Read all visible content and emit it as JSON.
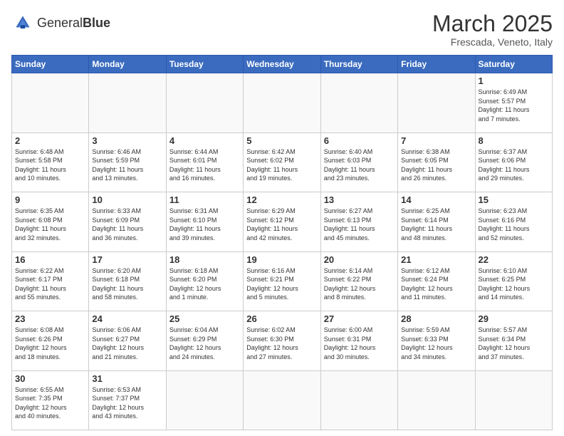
{
  "logo": {
    "text_normal": "General",
    "text_bold": "Blue"
  },
  "header": {
    "month": "March 2025",
    "location": "Frescada, Veneto, Italy"
  },
  "days_of_week": [
    "Sunday",
    "Monday",
    "Tuesday",
    "Wednesday",
    "Thursday",
    "Friday",
    "Saturday"
  ],
  "weeks": [
    [
      {
        "day": "",
        "info": ""
      },
      {
        "day": "",
        "info": ""
      },
      {
        "day": "",
        "info": ""
      },
      {
        "day": "",
        "info": ""
      },
      {
        "day": "",
        "info": ""
      },
      {
        "day": "",
        "info": ""
      },
      {
        "day": "1",
        "info": "Sunrise: 6:49 AM\nSunset: 5:57 PM\nDaylight: 11 hours\nand 7 minutes."
      }
    ],
    [
      {
        "day": "2",
        "info": "Sunrise: 6:48 AM\nSunset: 5:58 PM\nDaylight: 11 hours\nand 10 minutes."
      },
      {
        "day": "3",
        "info": "Sunrise: 6:46 AM\nSunset: 5:59 PM\nDaylight: 11 hours\nand 13 minutes."
      },
      {
        "day": "4",
        "info": "Sunrise: 6:44 AM\nSunset: 6:01 PM\nDaylight: 11 hours\nand 16 minutes."
      },
      {
        "day": "5",
        "info": "Sunrise: 6:42 AM\nSunset: 6:02 PM\nDaylight: 11 hours\nand 19 minutes."
      },
      {
        "day": "6",
        "info": "Sunrise: 6:40 AM\nSunset: 6:03 PM\nDaylight: 11 hours\nand 23 minutes."
      },
      {
        "day": "7",
        "info": "Sunrise: 6:38 AM\nSunset: 6:05 PM\nDaylight: 11 hours\nand 26 minutes."
      },
      {
        "day": "8",
        "info": "Sunrise: 6:37 AM\nSunset: 6:06 PM\nDaylight: 11 hours\nand 29 minutes."
      }
    ],
    [
      {
        "day": "9",
        "info": "Sunrise: 6:35 AM\nSunset: 6:08 PM\nDaylight: 11 hours\nand 32 minutes."
      },
      {
        "day": "10",
        "info": "Sunrise: 6:33 AM\nSunset: 6:09 PM\nDaylight: 11 hours\nand 36 minutes."
      },
      {
        "day": "11",
        "info": "Sunrise: 6:31 AM\nSunset: 6:10 PM\nDaylight: 11 hours\nand 39 minutes."
      },
      {
        "day": "12",
        "info": "Sunrise: 6:29 AM\nSunset: 6:12 PM\nDaylight: 11 hours\nand 42 minutes."
      },
      {
        "day": "13",
        "info": "Sunrise: 6:27 AM\nSunset: 6:13 PM\nDaylight: 11 hours\nand 45 minutes."
      },
      {
        "day": "14",
        "info": "Sunrise: 6:25 AM\nSunset: 6:14 PM\nDaylight: 11 hours\nand 48 minutes."
      },
      {
        "day": "15",
        "info": "Sunrise: 6:23 AM\nSunset: 6:16 PM\nDaylight: 11 hours\nand 52 minutes."
      }
    ],
    [
      {
        "day": "16",
        "info": "Sunrise: 6:22 AM\nSunset: 6:17 PM\nDaylight: 11 hours\nand 55 minutes."
      },
      {
        "day": "17",
        "info": "Sunrise: 6:20 AM\nSunset: 6:18 PM\nDaylight: 11 hours\nand 58 minutes."
      },
      {
        "day": "18",
        "info": "Sunrise: 6:18 AM\nSunset: 6:20 PM\nDaylight: 12 hours\nand 1 minute."
      },
      {
        "day": "19",
        "info": "Sunrise: 6:16 AM\nSunset: 6:21 PM\nDaylight: 12 hours\nand 5 minutes."
      },
      {
        "day": "20",
        "info": "Sunrise: 6:14 AM\nSunset: 6:22 PM\nDaylight: 12 hours\nand 8 minutes."
      },
      {
        "day": "21",
        "info": "Sunrise: 6:12 AM\nSunset: 6:24 PM\nDaylight: 12 hours\nand 11 minutes."
      },
      {
        "day": "22",
        "info": "Sunrise: 6:10 AM\nSunset: 6:25 PM\nDaylight: 12 hours\nand 14 minutes."
      }
    ],
    [
      {
        "day": "23",
        "info": "Sunrise: 6:08 AM\nSunset: 6:26 PM\nDaylight: 12 hours\nand 18 minutes."
      },
      {
        "day": "24",
        "info": "Sunrise: 6:06 AM\nSunset: 6:27 PM\nDaylight: 12 hours\nand 21 minutes."
      },
      {
        "day": "25",
        "info": "Sunrise: 6:04 AM\nSunset: 6:29 PM\nDaylight: 12 hours\nand 24 minutes."
      },
      {
        "day": "26",
        "info": "Sunrise: 6:02 AM\nSunset: 6:30 PM\nDaylight: 12 hours\nand 27 minutes."
      },
      {
        "day": "27",
        "info": "Sunrise: 6:00 AM\nSunset: 6:31 PM\nDaylight: 12 hours\nand 30 minutes."
      },
      {
        "day": "28",
        "info": "Sunrise: 5:59 AM\nSunset: 6:33 PM\nDaylight: 12 hours\nand 34 minutes."
      },
      {
        "day": "29",
        "info": "Sunrise: 5:57 AM\nSunset: 6:34 PM\nDaylight: 12 hours\nand 37 minutes."
      }
    ],
    [
      {
        "day": "30",
        "info": "Sunrise: 6:55 AM\nSunset: 7:35 PM\nDaylight: 12 hours\nand 40 minutes."
      },
      {
        "day": "31",
        "info": "Sunrise: 6:53 AM\nSunset: 7:37 PM\nDaylight: 12 hours\nand 43 minutes."
      },
      {
        "day": "",
        "info": ""
      },
      {
        "day": "",
        "info": ""
      },
      {
        "day": "",
        "info": ""
      },
      {
        "day": "",
        "info": ""
      },
      {
        "day": "",
        "info": ""
      }
    ]
  ]
}
